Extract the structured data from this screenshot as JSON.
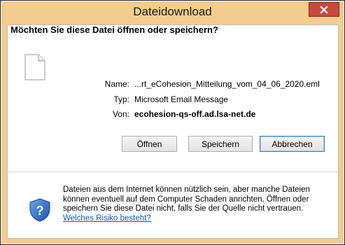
{
  "dialog": {
    "title": "Dateidownload",
    "question": "Möchten Sie diese Datei öffnen oder speichern?",
    "file": {
      "name_label": "Name:",
      "name_value": "...rt_eCohesion_Mitteilung_vom_04_06_2020.eml",
      "type_label": "Typ:",
      "type_value": "Microsoft Email Message",
      "from_label": "Von:",
      "from_value": "ecohesion-qs-off.ad.lsa-net.de"
    },
    "buttons": {
      "open": "Öffnen",
      "save": "Speichern",
      "cancel": "Abbrechen"
    },
    "warning": {
      "text": "Dateien aus dem Internet können nützlich sein, aber manche Dateien können eventuell auf dem Computer Schaden anrichten. Öffnen oder speichern Sie diese Datei nicht, falls Sie der Quelle nicht vertrauen.",
      "link": "Welches Risiko besteht?"
    }
  },
  "colors": {
    "titlebar": "#f3cc8e",
    "close_button": "#c64a3f",
    "link": "#0b57c8",
    "default_button_border": "#3c7fb1"
  },
  "icons": {
    "close": "close-icon",
    "file": "file-icon",
    "shield": "shield-question-icon"
  }
}
